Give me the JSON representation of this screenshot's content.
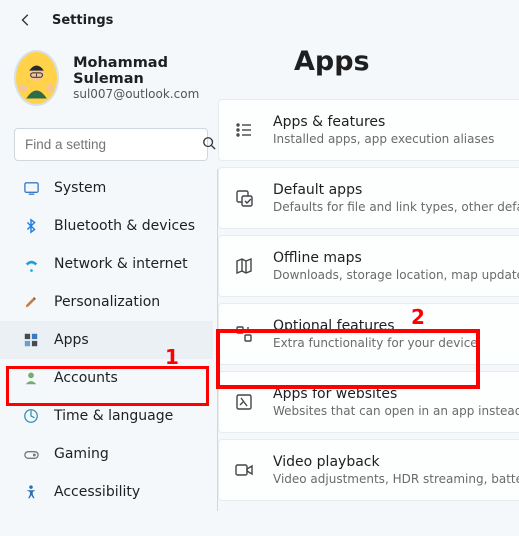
{
  "topbar": {
    "title": "Settings"
  },
  "profile": {
    "name": "Mohammad Suleman",
    "email": "sul007@outlook.com"
  },
  "search": {
    "placeholder": "Find a setting"
  },
  "sidebar": {
    "items": [
      {
        "label": "System"
      },
      {
        "label": "Bluetooth & devices"
      },
      {
        "label": "Network & internet"
      },
      {
        "label": "Personalization"
      },
      {
        "label": "Apps"
      },
      {
        "label": "Accounts"
      },
      {
        "label": "Time & language"
      },
      {
        "label": "Gaming"
      },
      {
        "label": "Accessibility"
      }
    ]
  },
  "page": {
    "title": "Apps"
  },
  "cards": [
    {
      "title": "Apps & features",
      "desc": "Installed apps, app execution aliases"
    },
    {
      "title": "Default apps",
      "desc": "Defaults for file and link types, other defa"
    },
    {
      "title": "Offline maps",
      "desc": "Downloads, storage location, map update"
    },
    {
      "title": "Optional features",
      "desc": "Extra functionality for your device"
    },
    {
      "title": "Apps for websites",
      "desc": "Websites that can open in an app instead"
    },
    {
      "title": "Video playback",
      "desc": "Video adjustments, HDR streaming, batter"
    }
  ],
  "annotations": {
    "one": "1",
    "two": "2"
  },
  "colors": {
    "highlight": "#ff0000"
  }
}
